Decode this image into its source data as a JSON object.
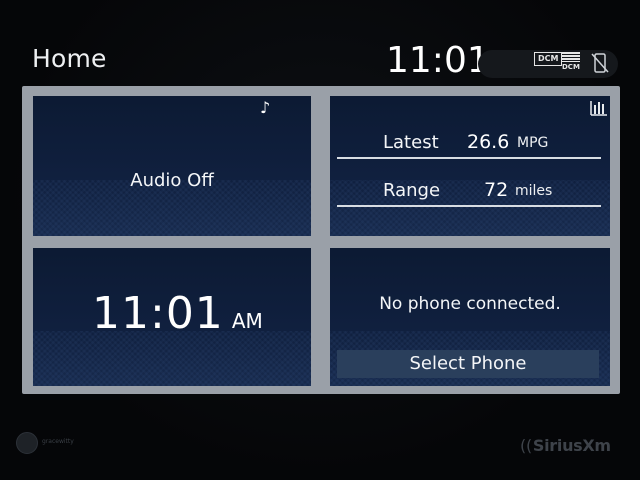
{
  "header": {
    "title": "Home",
    "clock": "11:01",
    "dcm_badge": "DCM",
    "dcm_signal_label": "DCM"
  },
  "icons": {
    "music": "music-note-icon",
    "equalizer": "bar-graph-icon",
    "phone_status": "phone-disconnected-icon",
    "dcm": "dcm-icon"
  },
  "audio_tile": {
    "label": "Audio Off",
    "icon_glyph": "♪"
  },
  "fuel_tile": {
    "rows": [
      {
        "label": "Latest",
        "value": "26.6",
        "unit": "MPG"
      },
      {
        "label": "Range",
        "value": "72",
        "unit": "miles"
      }
    ]
  },
  "clock_tile": {
    "time": "11:01",
    "ampm": "AM"
  },
  "phone_tile": {
    "message": "No phone connected.",
    "button_label": "Select Phone"
  },
  "footer": {
    "brand_logo_text": "SiriusXm",
    "watermark_text": "gracewitty"
  },
  "colors": {
    "tile_bg": "#10203f",
    "frame": "#9aa0a8",
    "button_bg": "#2a3f5c",
    "screen_bg": "#050608"
  }
}
